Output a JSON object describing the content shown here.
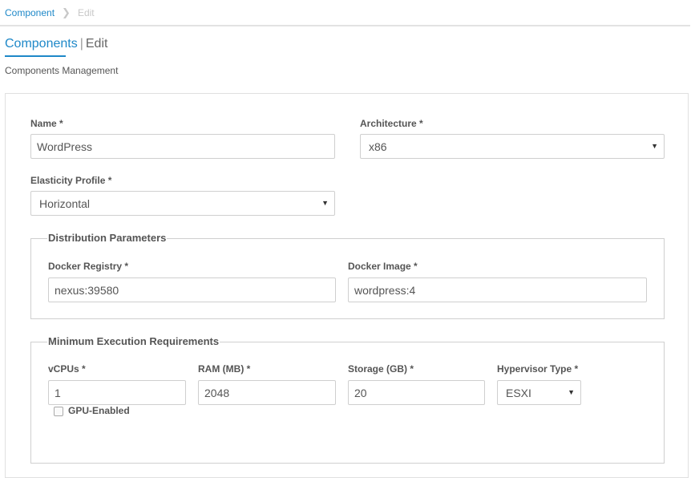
{
  "breadcrumb": {
    "parent": "Component",
    "current": "Edit"
  },
  "page": {
    "title_main": "Components",
    "title_sep": "|",
    "title_edit": "Edit",
    "subtitle": "Components Management"
  },
  "form": {
    "name": {
      "label": "Name *",
      "value": "WordPress"
    },
    "architecture": {
      "label": "Architecture *",
      "value": "x86"
    },
    "elasticity": {
      "label": "Elasticity Profile *",
      "value": "Horizontal"
    },
    "distribution": {
      "legend": "Distribution Parameters",
      "registry": {
        "label": "Docker Registry *",
        "value": "nexus:39580"
      },
      "image": {
        "label": "Docker Image *",
        "value": "wordpress:4"
      }
    },
    "requirements": {
      "legend": "Minimum Execution Requirements",
      "vcpus": {
        "label": "vCPUs *",
        "value": "1"
      },
      "ram": {
        "label": "RAM (MB) *",
        "value": "2048"
      },
      "storage": {
        "label": "Storage (GB) *",
        "value": "20"
      },
      "hypervisor": {
        "label": "Hypervisor Type *",
        "value": "ESXI"
      },
      "gpu": {
        "label": "GPU-Enabled",
        "checked": false
      }
    }
  },
  "icons": {
    "caret": "caret-down-icon",
    "chevron": "chevron-right-icon"
  },
  "colors": {
    "accent": "#1e88c8",
    "border": "#cfcfcf"
  }
}
